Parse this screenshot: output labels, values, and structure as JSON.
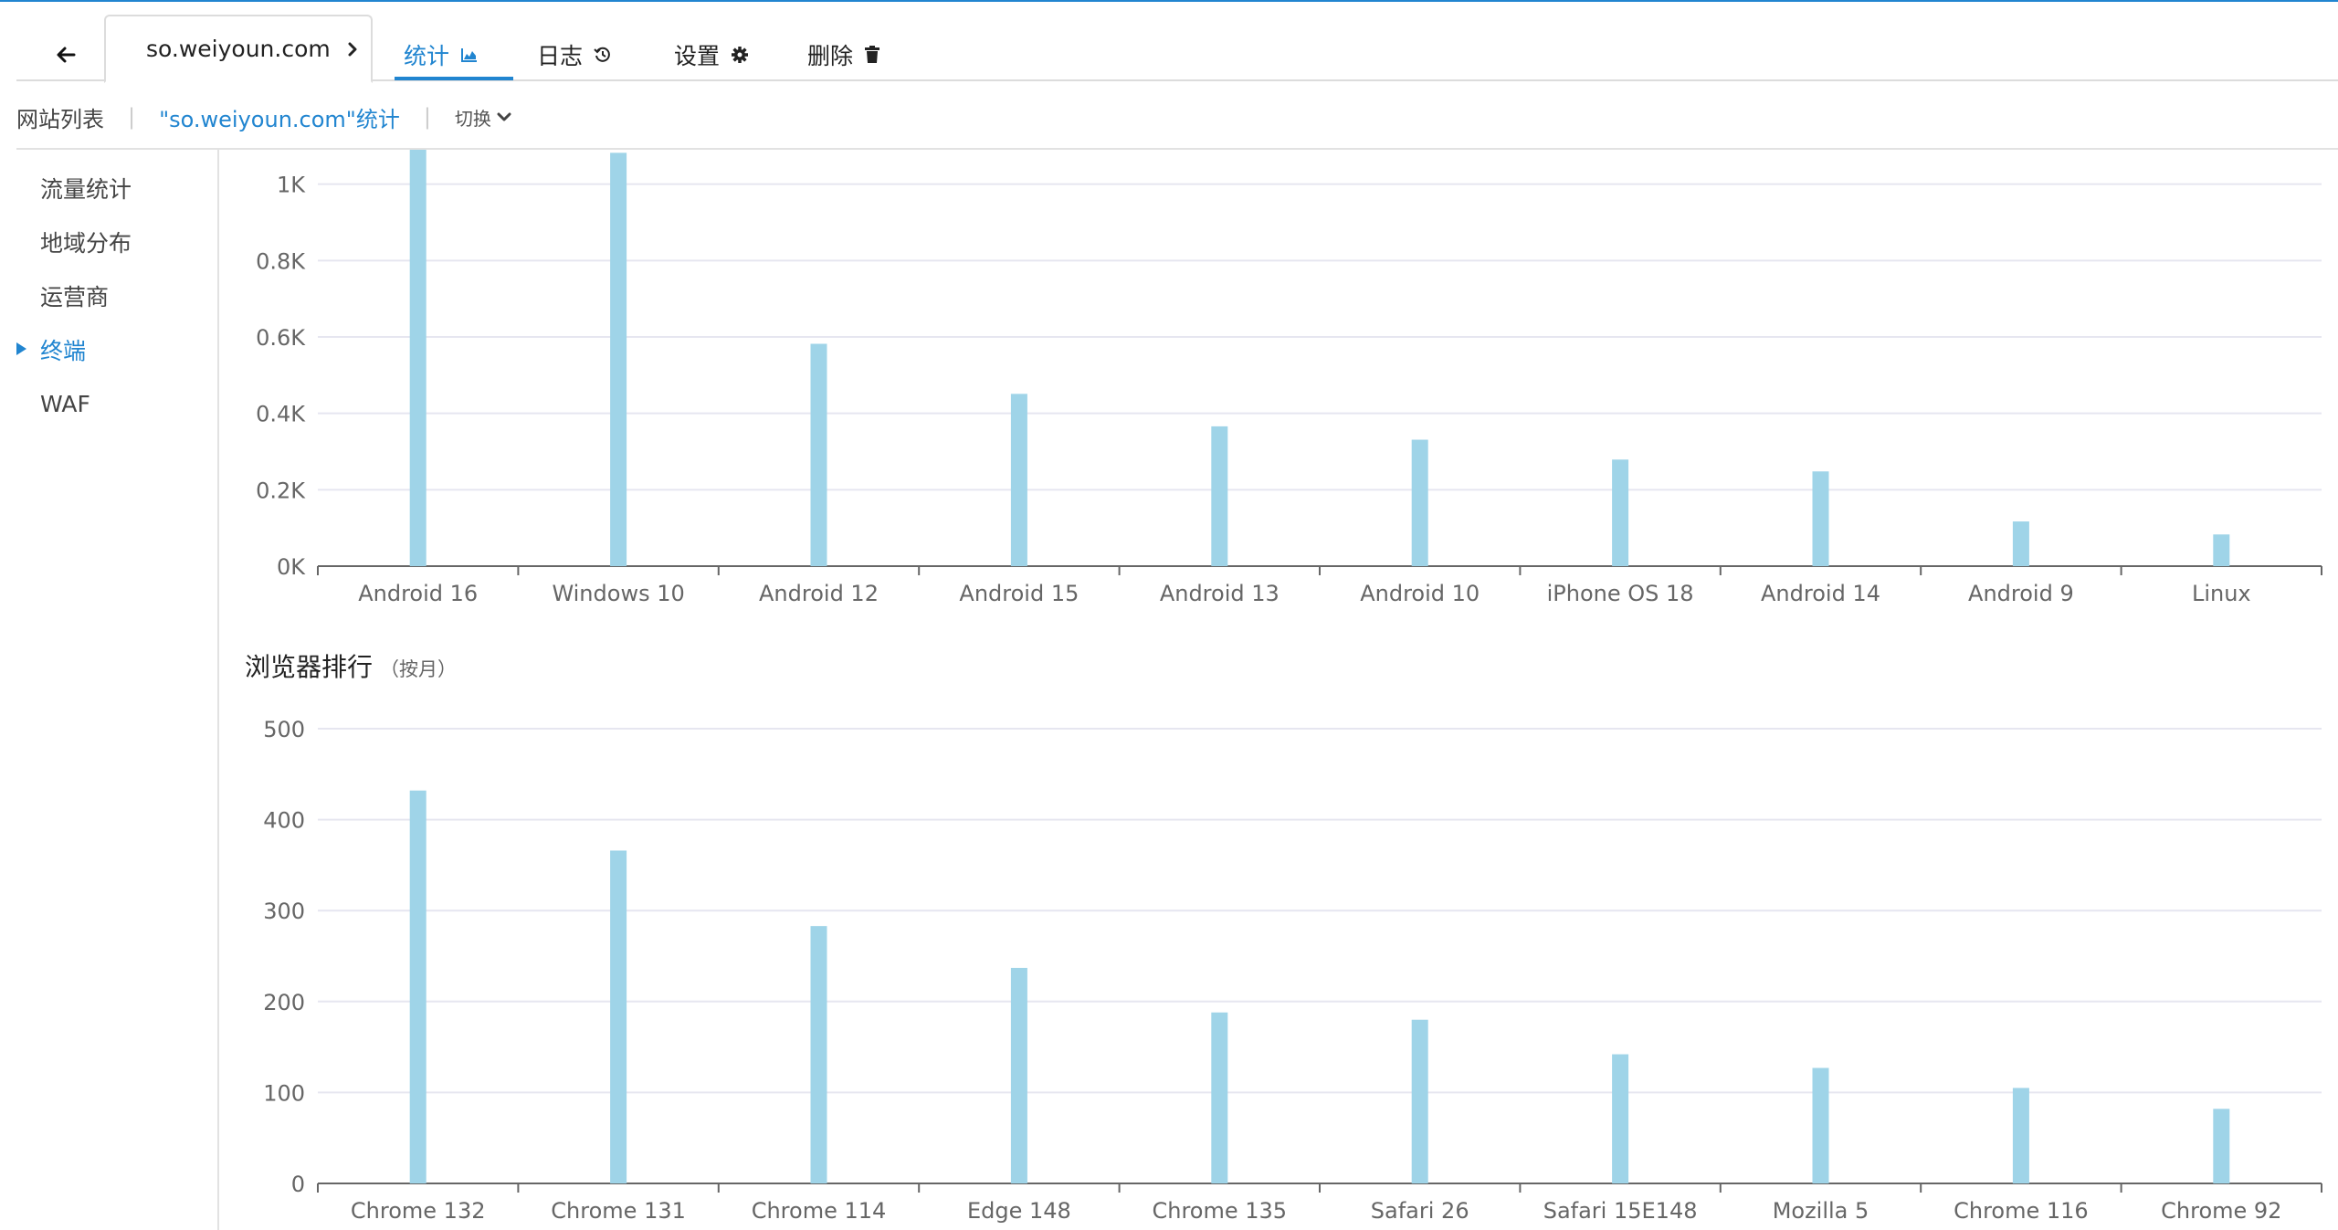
{
  "tabs": {
    "site": "so.weiyoun.com",
    "stats": "统计",
    "logs": "日志",
    "settings": "设置",
    "delete": "删除"
  },
  "breadcrumb": {
    "home": "网站列表",
    "current": "\"so.weiyoun.com\"统计",
    "switch": "切换"
  },
  "sidebar": {
    "items": [
      {
        "label": "流量统计"
      },
      {
        "label": "地域分布"
      },
      {
        "label": "运营商"
      },
      {
        "label": "终端",
        "active": true
      },
      {
        "label": "WAF"
      }
    ]
  },
  "colors": {
    "accent": "#2185d0",
    "bar": "#9fd4e8",
    "grid": "#e6e6f0",
    "axis": "#666666"
  },
  "browser_section": {
    "title": "浏览器排行",
    "subtitle": "（按月）"
  },
  "chart_data": [
    {
      "type": "bar",
      "categories": [
        "Android 16",
        "Windows 10",
        "Android 12",
        "Android 15",
        "Android 13",
        "Android 10",
        "iPhone OS 18",
        "Android 14",
        "Android 9",
        "Linux"
      ],
      "values": [
        1090,
        1082,
        582,
        451,
        366,
        331,
        279,
        248,
        117,
        83
      ],
      "ylim": [
        0,
        1090
      ],
      "yticks": [
        0,
        200,
        400,
        600,
        800,
        1000
      ],
      "ytick_labels": [
        "0K",
        "0.2K",
        "0.4K",
        "0.6K",
        "0.8K",
        "1K"
      ],
      "grid": true
    },
    {
      "type": "bar",
      "title": "浏览器排行",
      "categories": [
        "Chrome 132",
        "Chrome 131",
        "Chrome 114",
        "Edge 148",
        "Chrome 135",
        "Safari 26",
        "Safari 15E148",
        "Mozilla 5",
        "Chrome 116",
        "Chrome 92"
      ],
      "values": [
        432,
        366,
        283,
        237,
        188,
        180,
        142,
        127,
        105,
        82
      ],
      "ylim": [
        0,
        500
      ],
      "yticks": [
        0,
        100,
        200,
        300,
        400,
        500
      ],
      "ytick_labels": [
        "0",
        "100",
        "200",
        "300",
        "400",
        "500"
      ],
      "grid": true
    }
  ]
}
